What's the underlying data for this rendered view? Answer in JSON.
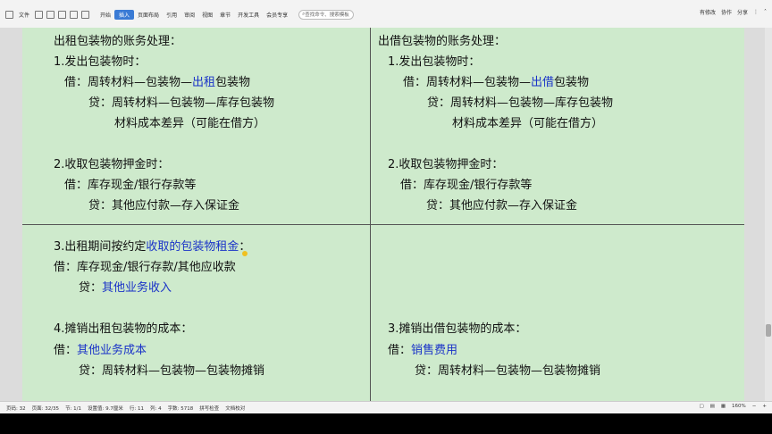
{
  "toolbar": {
    "file_menu": "文件",
    "tabs": [
      "开始",
      "插入",
      "页面布局",
      "引用",
      "审阅",
      "视图",
      "章节",
      "开发工具",
      "会员专享"
    ],
    "active_tab": "插入",
    "search_placeholder": "查找命令、搜索模板",
    "right_items": [
      "有修改",
      "协作",
      "分享"
    ]
  },
  "document": {
    "q1": {
      "title": "出租包装物的账务处理：",
      "step1": "1.发出包装物时：",
      "debit_prefix": "借：周转材料—包装物—",
      "debit_highlight": "出租",
      "debit_suffix": "包装物",
      "credit1": "贷：周转材料—包装物—库存包装物",
      "credit2": "材料成本差异（可能在借方）",
      "step2": "2.收取包装物押金时：",
      "step2_debit": "借：库存现金/银行存款等",
      "step2_credit": "贷：其他应付款—存入保证金"
    },
    "q2": {
      "title": "出借包装物的账务处理：",
      "step1": "1.发出包装物时：",
      "debit_prefix": "借：周转材料—包装物—",
      "debit_highlight": "出借",
      "debit_suffix": "包装物",
      "credit1": "贷：周转材料—包装物—库存包装物",
      "credit2": "材料成本差异（可能在借方）",
      "step2": "2.收取包装物押金时：",
      "step2_debit": "借：库存现金/银行存款等",
      "step2_credit": "贷：其他应付款—存入保证金"
    },
    "q3": {
      "step3_prefix": "3.出租期间按约定",
      "step3_highlight": "收取的包装物租金",
      "step3_suffix": "：",
      "debit": "借：库存现金/银行存款/其他应收款",
      "credit_prefix": "贷：",
      "credit_highlight": "其他业务收入",
      "step4": "4.摊销出租包装物的成本：",
      "step4_debit_prefix": "借：",
      "step4_debit_highlight": "其他业务成本",
      "step4_credit": "贷：周转材料—包装物—包装物摊销"
    },
    "q4": {
      "step3": "3.摊销出借包装物的成本：",
      "debit_prefix": "借：",
      "debit_highlight": "销售费用",
      "credit": "贷：周转材料—包装物—包装物摊销"
    }
  },
  "statusbar": {
    "page": "页码: 32",
    "pages": "页面: 32/35",
    "section": "节: 1/1",
    "setting": "设置值: 9.7厘米",
    "row": "行: 11",
    "col": "列: 4",
    "words": "字数: 5718",
    "spell": "拼写检查",
    "proof": "文档校对",
    "zoom": "160%"
  },
  "colors": {
    "page_bg": "#ceeacc",
    "highlight_text": "#1a33c8",
    "active_tab": "#3a7bd5"
  }
}
